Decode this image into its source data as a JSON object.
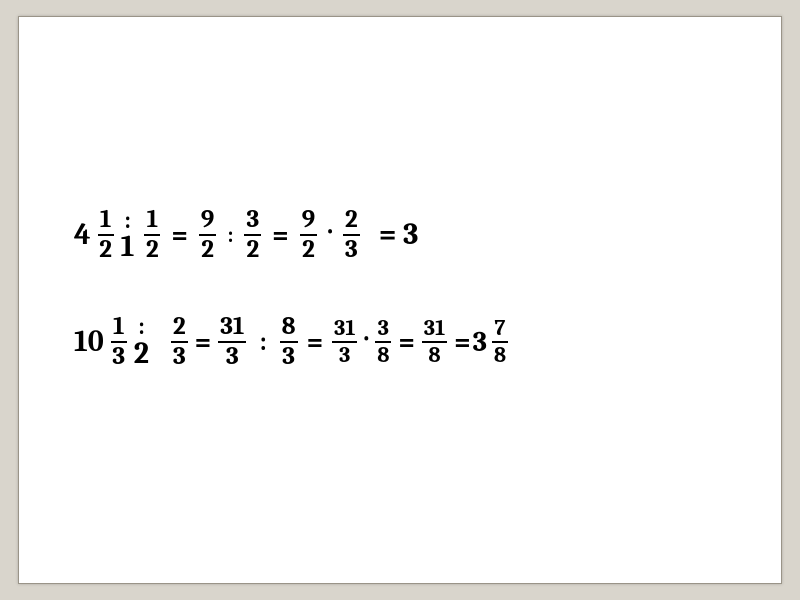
{
  "row1": {
    "lead_whole": "4",
    "lead_frac": {
      "n": "1",
      "d": "2"
    },
    "stack1": {
      "top": ":",
      "bot": "1"
    },
    "frac2": {
      "n": "1",
      "d": "2"
    },
    "eq1": "=",
    "frac3": {
      "n": "9",
      "d": "2"
    },
    "op_colon": ":",
    "frac4": {
      "n": "3",
      "d": "2"
    },
    "eq2": "=",
    "frac5": {
      "n": "9",
      "d": "2"
    },
    "op_dot": "·",
    "frac6": {
      "n": "2",
      "d": "3"
    },
    "eq3": "= 3"
  },
  "row2": {
    "lead_whole": "10",
    "lead_frac": {
      "n": "1",
      "d": "3"
    },
    "stack1": {
      "top": ":",
      "bot": "2"
    },
    "frac2": {
      "n": "2",
      "d": "3"
    },
    "eq1": "=",
    "frac3": {
      "n": "31",
      "d": "3"
    },
    "op_colon": ":",
    "frac4": {
      "n": "8",
      "d": "3"
    },
    "eq2": "=",
    "frac5": {
      "n": "31",
      "d": "3"
    },
    "op_dot": "·",
    "frac6": {
      "n": "3",
      "d": "8"
    },
    "eq3": "=",
    "frac7": {
      "n": "31",
      "d": "8"
    },
    "eq4": "=",
    "res_whole": "3",
    "res_frac": {
      "n": "7",
      "d": "8"
    }
  }
}
